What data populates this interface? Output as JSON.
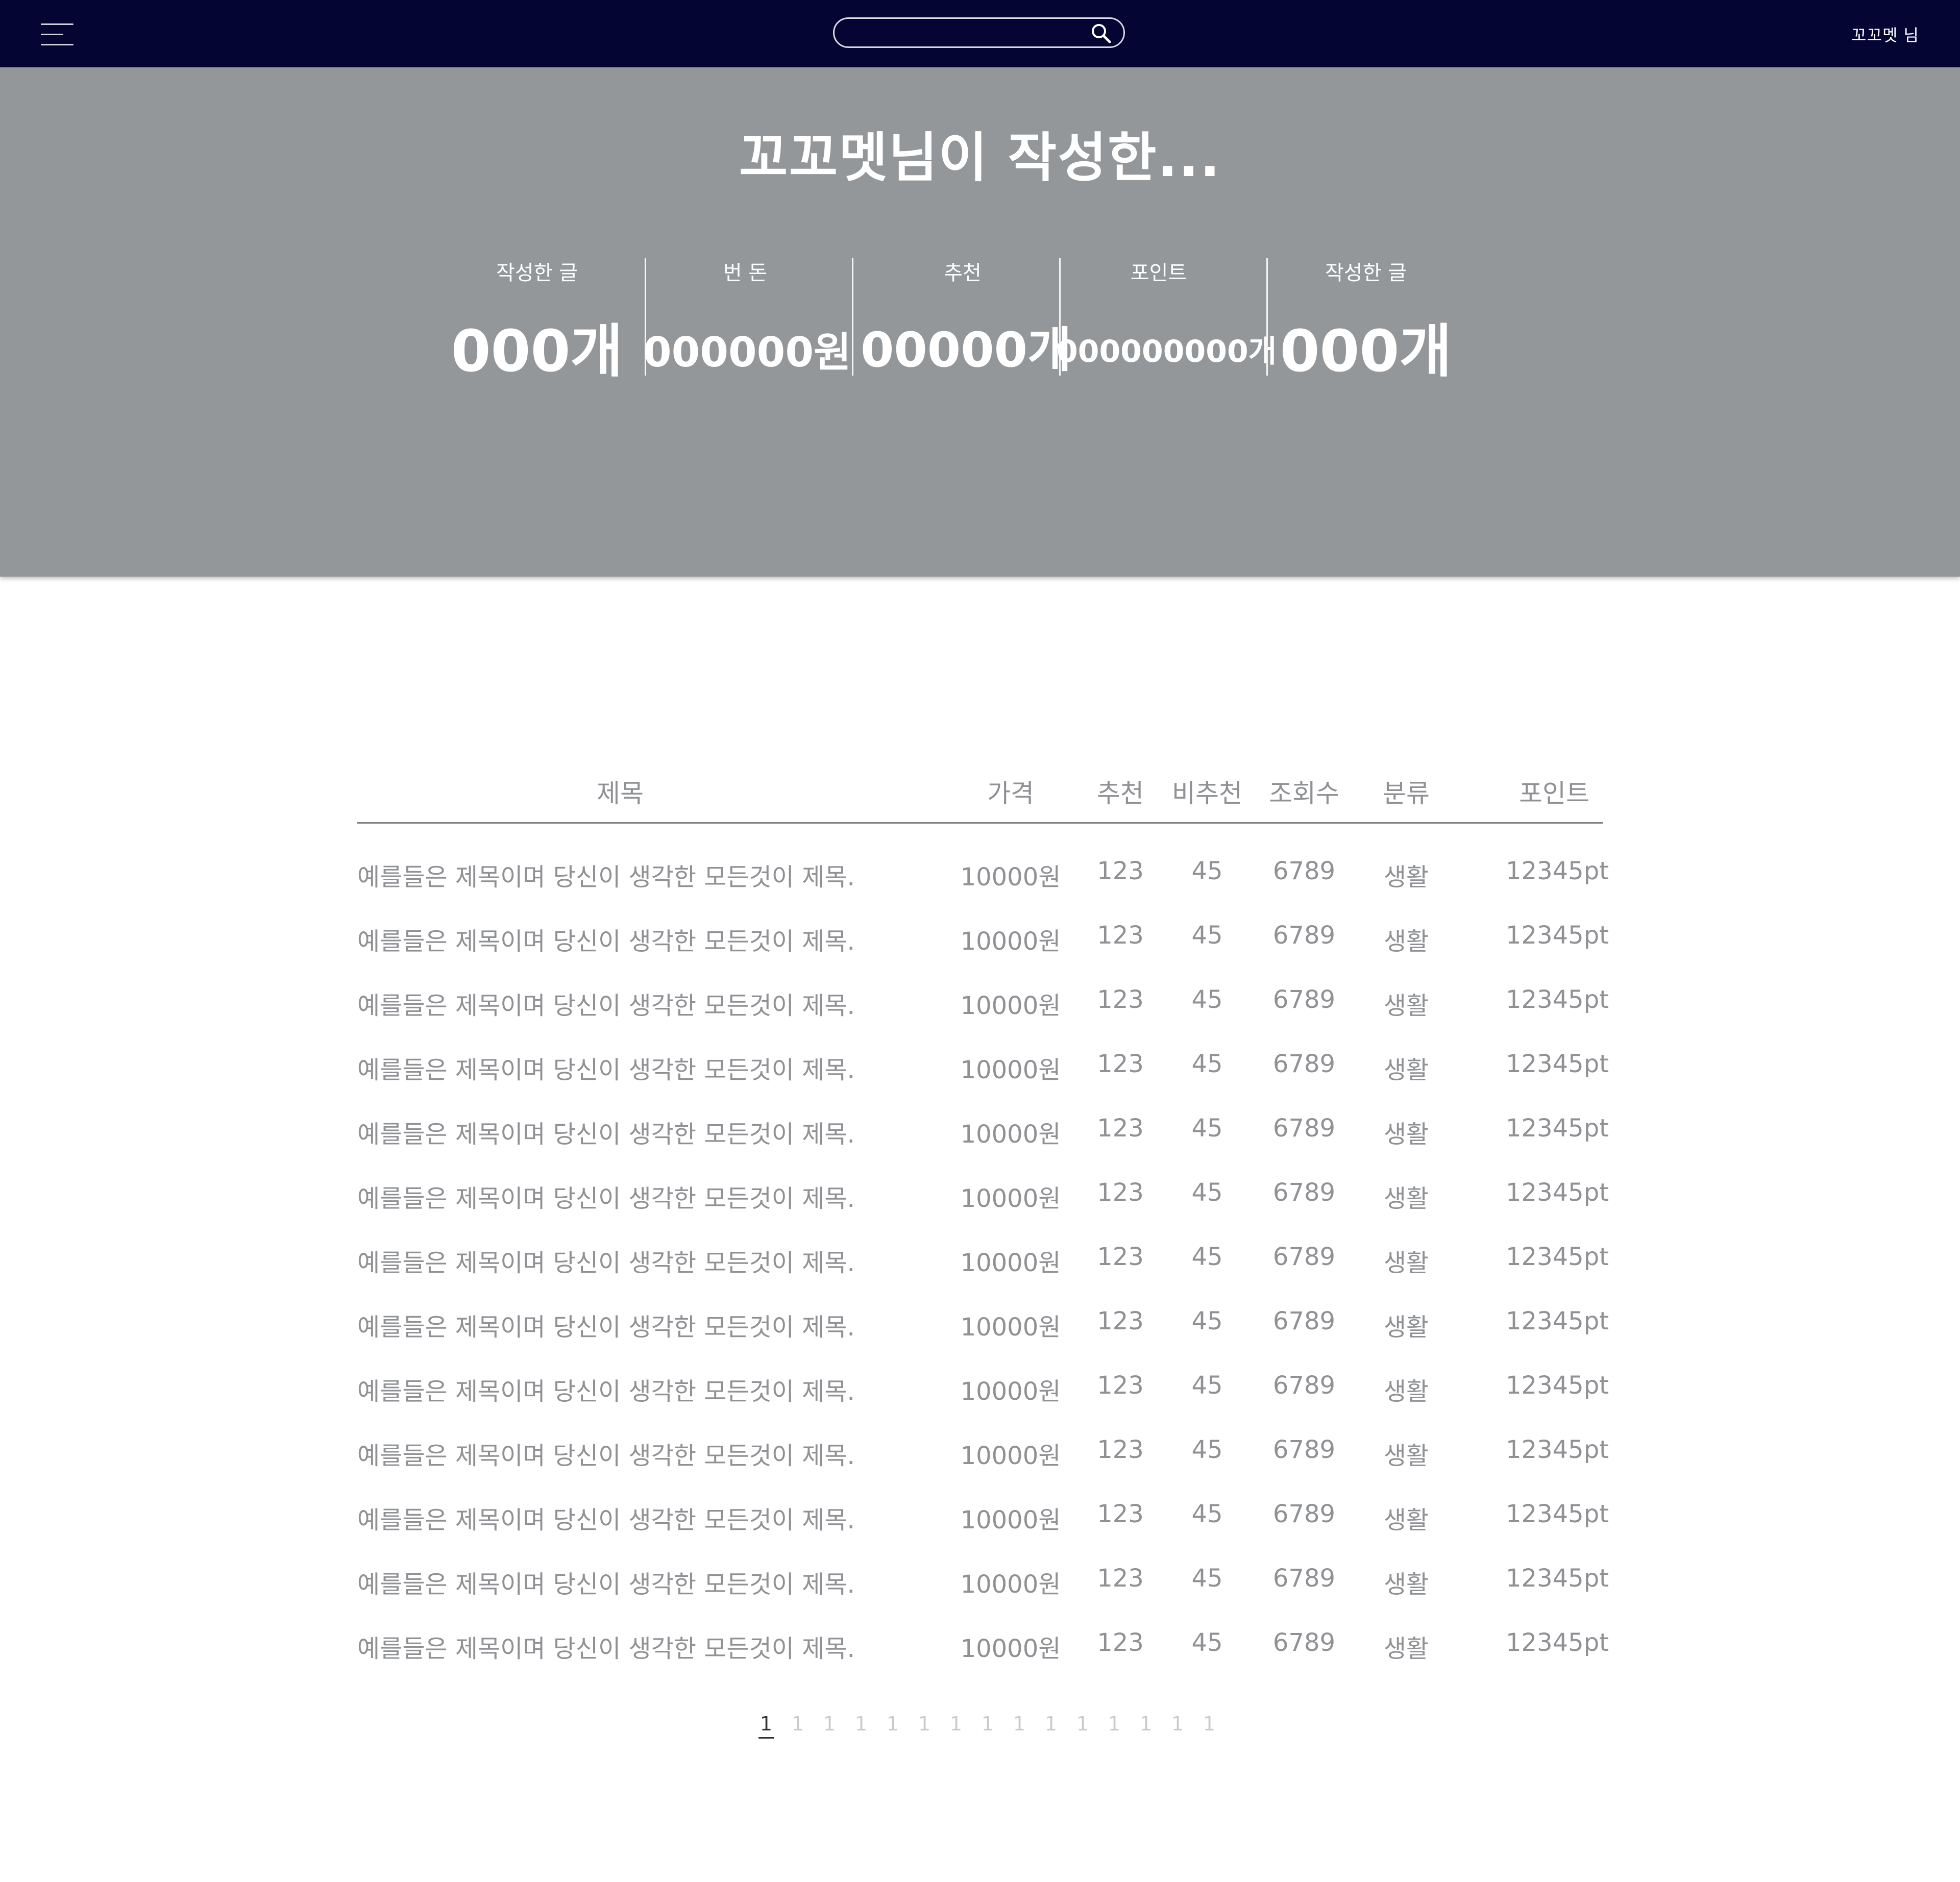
{
  "header": {
    "search_placeholder": "",
    "user_name": "꼬꼬멧 님"
  },
  "hero": {
    "title": "꼬꼬멧님이 작성한...",
    "stats": [
      {
        "label": "작성한 글",
        "value": "000개"
      },
      {
        "label": "번 돈",
        "value": "000000원"
      },
      {
        "label": "추천",
        "value": "00000개"
      },
      {
        "label": "포인트",
        "value": "000000000개"
      },
      {
        "label": "작성한 글",
        "value": "000개"
      }
    ]
  },
  "table": {
    "columns": [
      "제목",
      "가격",
      "추천",
      "비추천",
      "조회수",
      "분류",
      "포인트"
    ],
    "rows": [
      [
        "예를들은 제목이며 당신이 생각한 모든것이 제목.",
        "10000원",
        "123",
        "45",
        "6789",
        "생활",
        "12345pt"
      ],
      [
        "예를들은 제목이며 당신이 생각한 모든것이 제목.",
        "10000원",
        "123",
        "45",
        "6789",
        "생활",
        "12345pt"
      ],
      [
        "예를들은 제목이며 당신이 생각한 모든것이 제목.",
        "10000원",
        "123",
        "45",
        "6789",
        "생활",
        "12345pt"
      ],
      [
        "예를들은 제목이며 당신이 생각한 모든것이 제목.",
        "10000원",
        "123",
        "45",
        "6789",
        "생활",
        "12345pt"
      ],
      [
        "예를들은 제목이며 당신이 생각한 모든것이 제목.",
        "10000원",
        "123",
        "45",
        "6789",
        "생활",
        "12345pt"
      ],
      [
        "예를들은 제목이며 당신이 생각한 모든것이 제목.",
        "10000원",
        "123",
        "45",
        "6789",
        "생활",
        "12345pt"
      ],
      [
        "예를들은 제목이며 당신이 생각한 모든것이 제목.",
        "10000원",
        "123",
        "45",
        "6789",
        "생활",
        "12345pt"
      ],
      [
        "예를들은 제목이며 당신이 생각한 모든것이 제목.",
        "10000원",
        "123",
        "45",
        "6789",
        "생활",
        "12345pt"
      ],
      [
        "예를들은 제목이며 당신이 생각한 모든것이 제목.",
        "10000원",
        "123",
        "45",
        "6789",
        "생활",
        "12345pt"
      ],
      [
        "예를들은 제목이며 당신이 생각한 모든것이 제목.",
        "10000원",
        "123",
        "45",
        "6789",
        "생활",
        "12345pt"
      ],
      [
        "예를들은 제목이며 당신이 생각한 모든것이 제목.",
        "10000원",
        "123",
        "45",
        "6789",
        "생활",
        "12345pt"
      ],
      [
        "예를들은 제목이며 당신이 생각한 모든것이 제목.",
        "10000원",
        "123",
        "45",
        "6789",
        "생활",
        "12345pt"
      ],
      [
        "예를들은 제목이며 당신이 생각한 모든것이 제목.",
        "10000원",
        "123",
        "45",
        "6789",
        "생활",
        "12345pt"
      ]
    ]
  },
  "pagination": {
    "pages": [
      "1",
      "1",
      "1",
      "1",
      "1",
      "1",
      "1",
      "1",
      "1",
      "1",
      "1",
      "1",
      "1",
      "1",
      "1"
    ],
    "active_index": 0
  }
}
